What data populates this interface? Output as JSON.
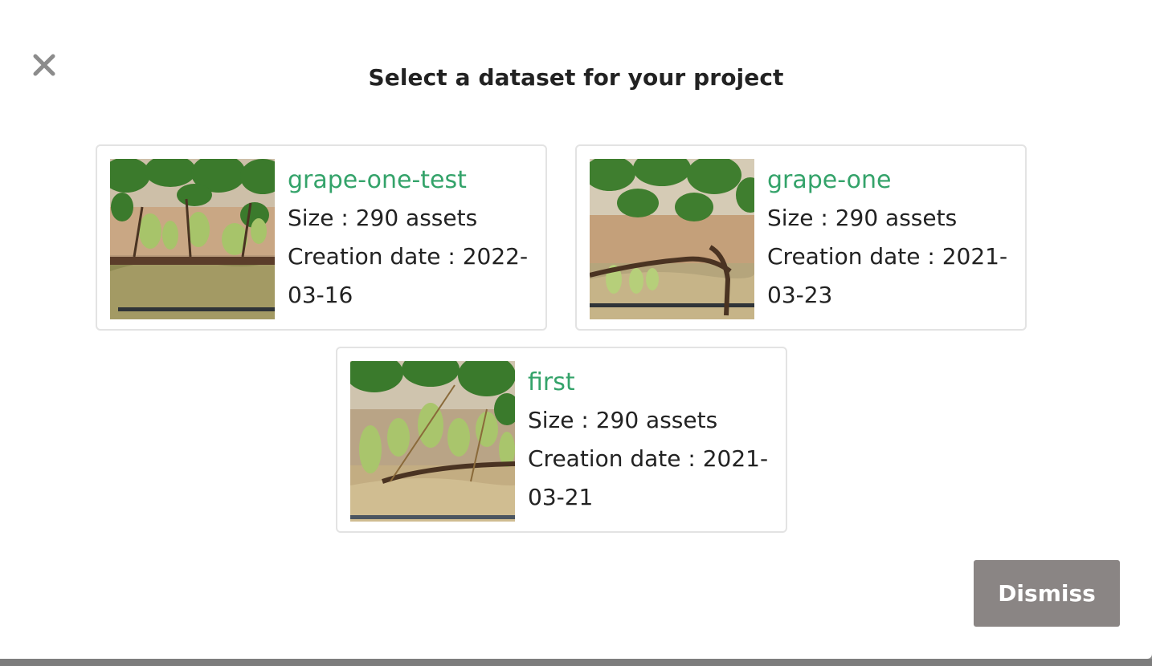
{
  "modal": {
    "title": "Select a dataset for your project",
    "close_icon": "close-x-icon",
    "dismiss_label": "Dismiss"
  },
  "datasets": [
    {
      "name": "grape-one-test",
      "size_text": "Size : 290 assets",
      "date_text": "Creation date : 2022-03-16"
    },
    {
      "name": "grape-one",
      "size_text": "Size : 290 assets",
      "date_text": "Creation date : 2021-03-23"
    },
    {
      "name": "first",
      "size_text": "Size : 290 assets",
      "date_text": "Creation date : 2021-03-21"
    }
  ],
  "colors": {
    "accent": "#34a36a",
    "dismiss_bg": "#8a8584",
    "card_border": "#e3e3e3"
  }
}
